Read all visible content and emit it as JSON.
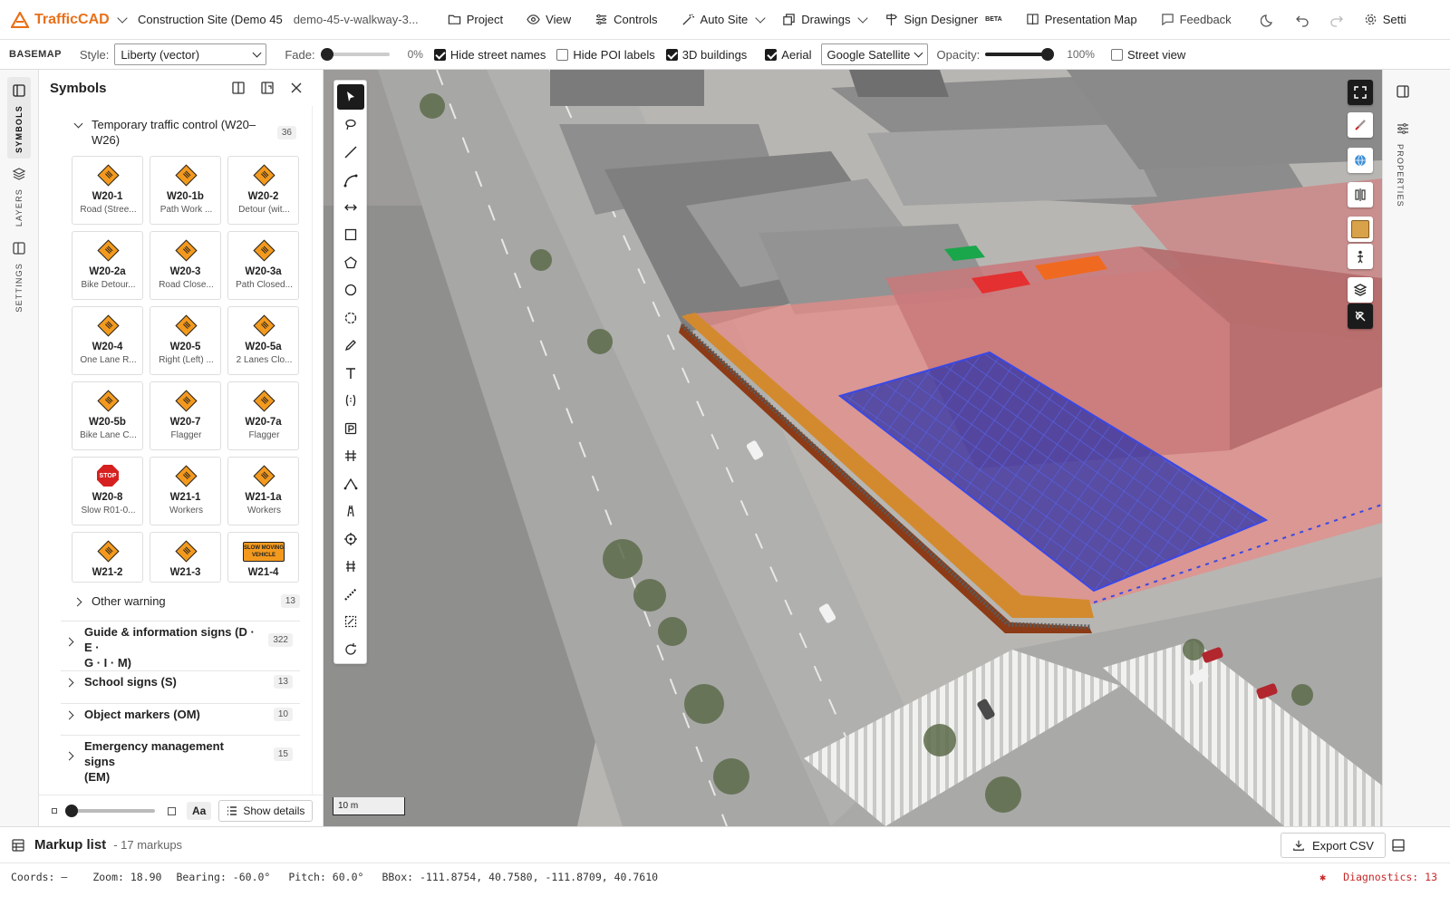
{
  "app": {
    "name": "TrafficCAD",
    "project_title": "Construction Site (Demo 45",
    "project_slug": "demo-45-v-walkway-3..."
  },
  "menu": {
    "project": "Project",
    "view": "View",
    "controls": "Controls",
    "auto_site": "Auto Site",
    "drawings": "Drawings",
    "sign_designer": "Sign Designer",
    "sign_designer_badge": "BETA",
    "presentation_map": "Presentation Map",
    "feedback": "Feedback",
    "settings": "Setti"
  },
  "basemap": {
    "section": "BASEMAP",
    "style_label": "Style:",
    "style_value": "Liberty (vector)",
    "fade_label": "Fade:",
    "fade_value": "0%",
    "fade_level": 0,
    "hide_street_names": "Hide street names",
    "hide_street_names_checked": true,
    "hide_poi_labels": "Hide POI labels",
    "hide_poi_labels_checked": false,
    "buildings_3d": "3D buildings",
    "buildings_3d_checked": true,
    "aerial": "Aerial",
    "aerial_checked": true,
    "aerial_source": "Google Satellite",
    "opacity_label": "Opacity:",
    "opacity_value": "100%",
    "opacity_level": 1,
    "street_view": "Street view",
    "street_view_checked": false
  },
  "left_rail": {
    "symbols": "SYMBOLS",
    "layers": "LAYERS",
    "settings": "SETTINGS"
  },
  "symbols_panel": {
    "title": "Symbols",
    "expanded_category": {
      "label": "Temporary traffic control (W20–W26)",
      "label_line1": "Temporary traffic control (W20–",
      "label_line2": "W26)",
      "count": "36"
    },
    "tiles": [
      {
        "code": "W20-1",
        "desc": "Road (Stree...",
        "shape": "diamond"
      },
      {
        "code": "W20-1b",
        "desc": "Path Work ...",
        "shape": "diamond"
      },
      {
        "code": "W20-2",
        "desc": "Detour (wit...",
        "shape": "diamond"
      },
      {
        "code": "W20-2a",
        "desc": "Bike Detour...",
        "shape": "diamond"
      },
      {
        "code": "W20-3",
        "desc": "Road Close...",
        "shape": "diamond"
      },
      {
        "code": "W20-3a",
        "desc": "Path Closed...",
        "shape": "diamond"
      },
      {
        "code": "W20-4",
        "desc": "One Lane R...",
        "shape": "diamond"
      },
      {
        "code": "W20-5",
        "desc": "Right (Left) ...",
        "shape": "diamond"
      },
      {
        "code": "W20-5a",
        "desc": "2 Lanes Clo...",
        "shape": "diamond"
      },
      {
        "code": "W20-5b",
        "desc": "Bike Lane C...",
        "shape": "diamond"
      },
      {
        "code": "W20-7",
        "desc": "Flagger",
        "shape": "diamond"
      },
      {
        "code": "W20-7a",
        "desc": "Flagger",
        "shape": "diamond"
      },
      {
        "code": "W20-8",
        "desc": "Slow R01-0...",
        "shape": "octagon"
      },
      {
        "code": "W21-1",
        "desc": "Workers",
        "shape": "diamond"
      },
      {
        "code": "W21-1a",
        "desc": "Workers",
        "shape": "diamond"
      },
      {
        "code": "W21-2",
        "desc": "",
        "shape": "diamond"
      },
      {
        "code": "W21-3",
        "desc": "",
        "shape": "diamond"
      },
      {
        "code": "W21-4",
        "desc": "",
        "shape": "rect"
      }
    ],
    "stop_text": "STOP",
    "slow_moving_text": "SLOW MOVING VEHICLE",
    "categories": [
      {
        "label1": "Other warning",
        "label2": "",
        "count": "13"
      },
      {
        "label1": "Guide & information signs (D · E ·",
        "label2": "G · I · M)",
        "count": "322"
      },
      {
        "label1": "School signs (S)",
        "label2": "",
        "count": "13"
      },
      {
        "label1": "Object markers (OM)",
        "label2": "",
        "count": "10"
      },
      {
        "label1": "Emergency management signs",
        "label2": "(EM)",
        "count": "15"
      }
    ],
    "footer": {
      "aa": "Aa",
      "show_details": "Show details"
    }
  },
  "map": {
    "scale_label": "10 m"
  },
  "right_rail": {
    "properties": "PROPERTIES"
  },
  "markup_list": {
    "title": "Markup list",
    "count": "- 17 markups",
    "export": "Export CSV"
  },
  "status": {
    "coords": "Coords: —",
    "zoom": "Zoom: 18.90",
    "bearing": "Bearing: -60.0°",
    "pitch": "Pitch: 60.0°",
    "bbox": "BBox: -111.8754, 40.7580, -111.8709, 40.7610",
    "diagnostics": "Diagnostics: 13"
  },
  "colors": {
    "brand": "#e8701a",
    "sign_orange": "#f39a1e",
    "site_overlay": "#e88a86",
    "work_zone": "#2632b8",
    "walkway": "#d38a2e",
    "diagnostics": "#c62828"
  }
}
